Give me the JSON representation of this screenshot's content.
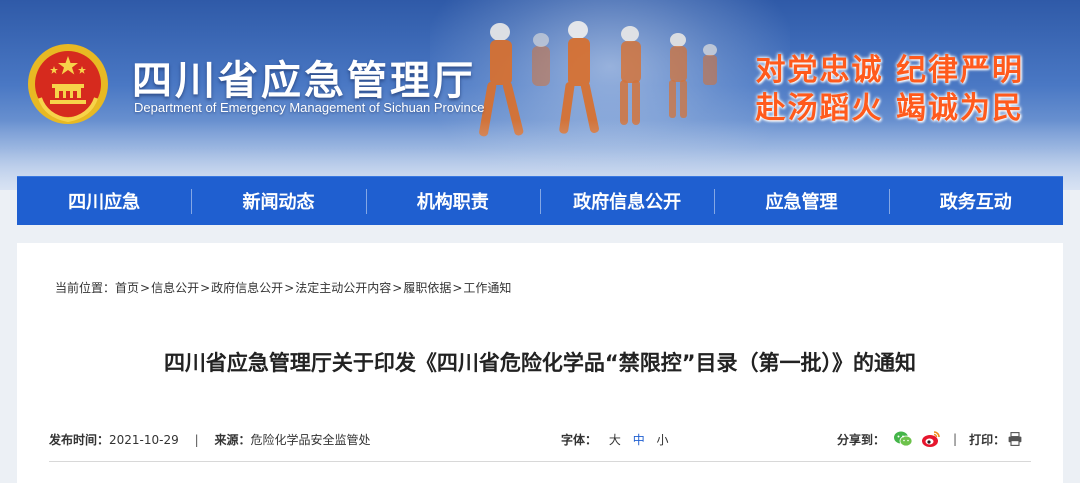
{
  "header": {
    "title": "四川省应急管理厅",
    "subtitle": "Department of Emergency Management of Sichuan Province",
    "slogan_line1": "对党忠诚  纪律严明",
    "slogan_line2": "赴汤蹈火  竭诚为民"
  },
  "nav": {
    "items": [
      {
        "label": "四川应急"
      },
      {
        "label": "新闻动态"
      },
      {
        "label": "机构职责"
      },
      {
        "label": "政府信息公开"
      },
      {
        "label": "应急管理"
      },
      {
        "label": "政务互动"
      }
    ]
  },
  "breadcrumb": {
    "prefix": "当前位置：",
    "items": [
      {
        "label": "首页"
      },
      {
        "label": "信息公开"
      },
      {
        "label": "政府信息公开"
      },
      {
        "label": "法定主动公开内容"
      },
      {
        "label": "履职依据"
      },
      {
        "label": "工作通知"
      }
    ],
    "separator": ">"
  },
  "article": {
    "title": "四川省应急管理厅关于印发《四川省危险化学品“禁限控”目录（第一批）》的通知",
    "publish_label": "发布时间：",
    "publish_date": "2021-10-29",
    "source_label": "来源：",
    "source": "危险化学品安全监管处",
    "separator": "|"
  },
  "font_size": {
    "label": "字体：",
    "options": [
      "大",
      "中",
      "小"
    ],
    "selected": "中"
  },
  "share": {
    "label": "分享到：",
    "icons": [
      "wechat-icon",
      "weibo-icon"
    ],
    "print_label": "打印：",
    "print_icon": "printer-icon"
  },
  "colors": {
    "nav_bg": "#1f5fd0",
    "slogan": "#ff5a1c",
    "accent": "#1f5fd0"
  }
}
